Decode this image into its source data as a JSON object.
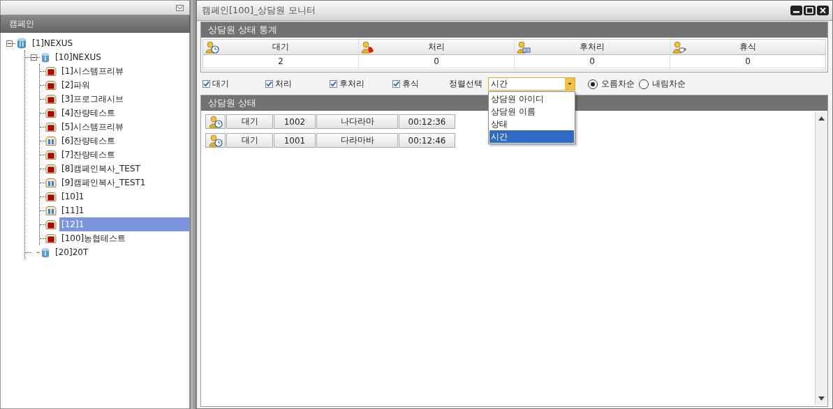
{
  "left_panel": {
    "header": "캠페인",
    "tree": [
      {
        "label": "[1]NEXUS",
        "expanded": true,
        "selected": false,
        "children": [
          {
            "label": "[10]NEXUS",
            "expanded": true,
            "selected": false,
            "children": [
              {
                "label": "[1]시스템프리뷰",
                "kind": "square",
                "selected": false
              },
              {
                "label": "[2]파워",
                "kind": "square",
                "selected": false
              },
              {
                "label": "[3]프로그래시브",
                "kind": "square",
                "selected": false
              },
              {
                "label": "[4]잔량테스트",
                "kind": "square",
                "selected": false
              },
              {
                "label": "[5]시스템프리뷰",
                "kind": "square",
                "selected": false
              },
              {
                "label": "[6]잔량테스트",
                "kind": "bars",
                "selected": false
              },
              {
                "label": "[7]잔량테스트",
                "kind": "square",
                "selected": false
              },
              {
                "label": "[8]캠페인복사_TEST",
                "kind": "square",
                "selected": false
              },
              {
                "label": "[9]캠페인복사_TEST1",
                "kind": "bars",
                "selected": false
              },
              {
                "label": "[10]1",
                "kind": "square",
                "selected": false
              },
              {
                "label": "[11]1",
                "kind": "bars",
                "selected": false
              },
              {
                "label": "[12]1",
                "kind": "square",
                "selected": true
              },
              {
                "label": "[100]농협테스트",
                "kind": "square",
                "selected": false
              }
            ]
          },
          {
            "label": "[20]20T",
            "selected": false
          }
        ]
      }
    ]
  },
  "window": {
    "title": "캠페인[100]_상담원 모니터"
  },
  "stats": {
    "title": "상담원 상태 통계",
    "columns": [
      {
        "kind": "clock",
        "label": "대기",
        "value": "2"
      },
      {
        "kind": "phone",
        "label": "처리",
        "value": "0"
      },
      {
        "kind": "keyboard",
        "label": "후처리",
        "value": "0"
      },
      {
        "kind": "cup",
        "label": "휴식",
        "value": "0"
      }
    ]
  },
  "filters": [
    {
      "label": "대기",
      "checked": true
    },
    {
      "label": "처리",
      "checked": true
    },
    {
      "label": "후처리",
      "checked": true
    },
    {
      "label": "휴식",
      "checked": true
    }
  ],
  "sort": {
    "label": "정렬선택",
    "value": "시간",
    "expanded": true,
    "options": [
      {
        "label": "상담원 아이디",
        "selected": false
      },
      {
        "label": "상담원 이름",
        "selected": false
      },
      {
        "label": "상태",
        "selected": false
      },
      {
        "label": "시간",
        "selected": true
      }
    ]
  },
  "order": [
    {
      "label": "오름차순",
      "selected": true
    },
    {
      "label": "내림차순",
      "selected": false
    }
  ],
  "agents": {
    "title": "상담원 상태",
    "rows": [
      {
        "status": "대기",
        "id": "1002",
        "name": "나다라마",
        "time": "00:12:36"
      },
      {
        "status": "대기",
        "id": "1001",
        "name": "다라마바",
        "time": "00:12:46"
      }
    ]
  }
}
